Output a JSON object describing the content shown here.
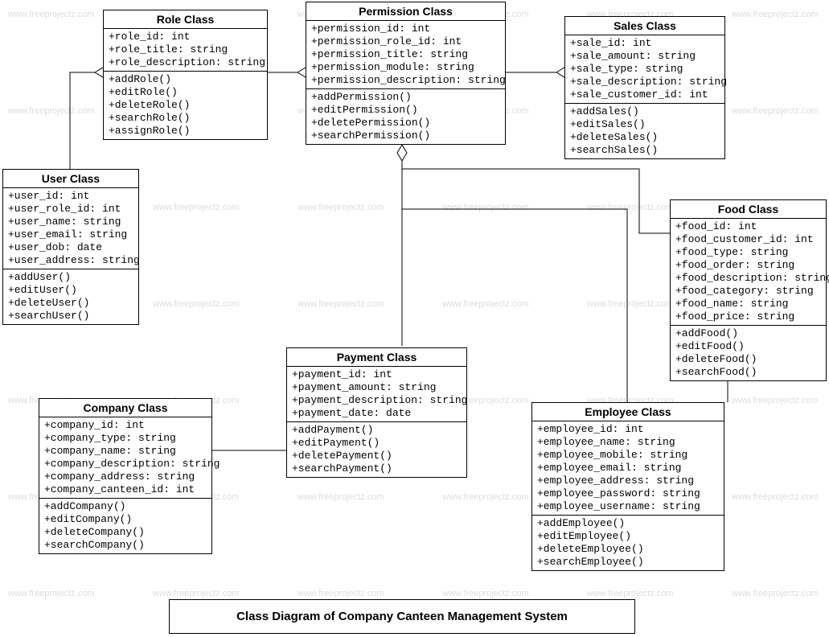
{
  "watermark_text": "www.freeprojectz.com",
  "caption": "Class Diagram of Company Canteen Management System",
  "classes": {
    "role": {
      "title": "Role Class",
      "attrs": [
        "+role_id: int",
        "+role_title: string",
        "+role_description: string"
      ],
      "ops": [
        "+addRole()",
        "+editRole()",
        "+deleteRole()",
        "+searchRole()",
        "+assignRole()"
      ]
    },
    "permission": {
      "title": "Permission Class",
      "attrs": [
        "+permission_id: int",
        "+permission_role_id: int",
        "+permission_title: string",
        "+permission_module: string",
        "+permission_description: string"
      ],
      "ops": [
        "+addPermission()",
        "+editPermission()",
        "+deletePermission()",
        "+searchPermission()"
      ]
    },
    "sales": {
      "title": "Sales Class",
      "attrs": [
        "+sale_id: int",
        "+sale_amount: string",
        "+sale_type: string",
        "+sale_description: string",
        "+sale_customer_id: int"
      ],
      "ops": [
        "+addSales()",
        "+editSales()",
        "+deleteSales()",
        "+searchSales()"
      ]
    },
    "user": {
      "title": "User Class",
      "attrs": [
        "+user_id: int",
        "+user_role_id: int",
        "+user_name: string",
        "+user_email: string",
        "+user_dob: date",
        "+user_address: string"
      ],
      "ops": [
        "+addUser()",
        "+editUser()",
        "+deleteUser()",
        "+searchUser()"
      ]
    },
    "food": {
      "title": "Food Class",
      "attrs": [
        "+food_id: int",
        "+food_customer_id: int",
        "+food_type: string",
        "+food_order: string",
        "+food_description: string",
        "+food_category: string",
        "+food_name: string",
        "+food_price: string"
      ],
      "ops": [
        "+addFood()",
        "+editFood()",
        "+deleteFood()",
        "+searchFood()"
      ]
    },
    "payment": {
      "title": "Payment Class",
      "attrs": [
        "+payment_id: int",
        "+payment_amount: string",
        "+payment_description: string",
        "+payment_date: date"
      ],
      "ops": [
        "+addPayment()",
        "+editPayment()",
        "+deletePayment()",
        "+searchPayment()"
      ]
    },
    "company": {
      "title": "Company Class",
      "attrs": [
        "+company_id: int",
        "+company_type: string",
        "+company_name: string",
        "+company_description: string",
        "+company_address: string",
        "+company_canteen_id: int"
      ],
      "ops": [
        "+addCompany()",
        "+editCompany()",
        "+deleteCompany()",
        "+searchCompany()"
      ]
    },
    "employee": {
      "title": "Employee Class",
      "attrs": [
        "+employee_id: int",
        "+employee_name: string",
        "+employee_mobile: string",
        "+employee_email: string",
        "+employee_address: string",
        "+employee_password: string",
        "+employee_username: string"
      ],
      "ops": [
        "+addEmployee()",
        "+editEmployee()",
        "+deleteEmployee()",
        "+searchEmployee()"
      ]
    }
  },
  "chart_data": {
    "type": "uml-class-diagram",
    "title": "Class Diagram of Company Canteen Management System",
    "classes": [
      "Role Class",
      "Permission Class",
      "Sales Class",
      "User Class",
      "Food Class",
      "Payment Class",
      "Company Class",
      "Employee Class"
    ],
    "relationships": [
      {
        "from": "User Class",
        "to": "Role Class",
        "type": "aggregation"
      },
      {
        "from": "Role Class",
        "to": "Permission Class",
        "type": "aggregation"
      },
      {
        "from": "Permission Class",
        "to": "Sales Class",
        "type": "aggregation"
      },
      {
        "from": "Permission Class",
        "to": "Payment Class",
        "type": "aggregation"
      },
      {
        "from": "Permission Class",
        "to": "Food Class",
        "type": "association"
      },
      {
        "from": "Permission Class",
        "to": "Employee Class",
        "type": "association"
      },
      {
        "from": "Employee Class",
        "to": "Food Class",
        "type": "association"
      },
      {
        "from": "Company Class",
        "to": "Payment Class",
        "type": "association"
      }
    ]
  }
}
